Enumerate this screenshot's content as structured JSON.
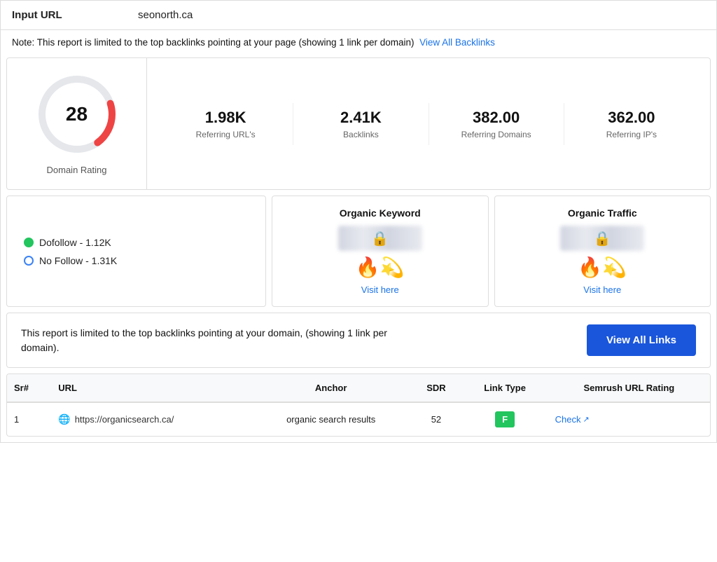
{
  "inputUrl": {
    "label": "Input URL",
    "value": "seonorth.ca"
  },
  "note": {
    "text": "Note: This report is limited to the top backlinks pointing at your page (showing 1 link per domain)",
    "linkText": "View All Backlinks",
    "linkHref": "#"
  },
  "domainRating": {
    "label": "Domain Rating",
    "value": "28"
  },
  "metrics": [
    {
      "value": "1.98K",
      "label": "Referring URL's"
    },
    {
      "value": "2.41K",
      "label": "Backlinks"
    },
    {
      "value": "382.00",
      "label": "Referring Domains"
    },
    {
      "value": "362.00",
      "label": "Referring IP's"
    }
  ],
  "linkTypes": [
    {
      "type": "dofollow",
      "label": "Dofollow - 1.12K",
      "dotClass": "dot-green"
    },
    {
      "type": "nofollow",
      "label": "No Follow - 1.31K",
      "dotClass": "dot-blue"
    }
  ],
  "organicKeyword": {
    "title": "Organic Keyword",
    "visitLabel": "Visit here",
    "visitHref": "#"
  },
  "organicTraffic": {
    "title": "Organic Traffic",
    "visitLabel": "Visit here",
    "visitHref": "#"
  },
  "viewAllBanner": {
    "text": "This report is limited to the top backlinks pointing at your domain, (showing 1 link per domain).",
    "buttonLabel": "View All Links"
  },
  "table": {
    "columns": [
      "Sr#",
      "URL",
      "Anchor",
      "SDR",
      "Link Type",
      "Semrush URL Rating"
    ],
    "rows": [
      {
        "sr": "1",
        "url": "https://organicsearch.ca/",
        "anchor": "organic search results",
        "sdr": "52",
        "linkType": "F",
        "semrushRating": "Check"
      }
    ]
  }
}
